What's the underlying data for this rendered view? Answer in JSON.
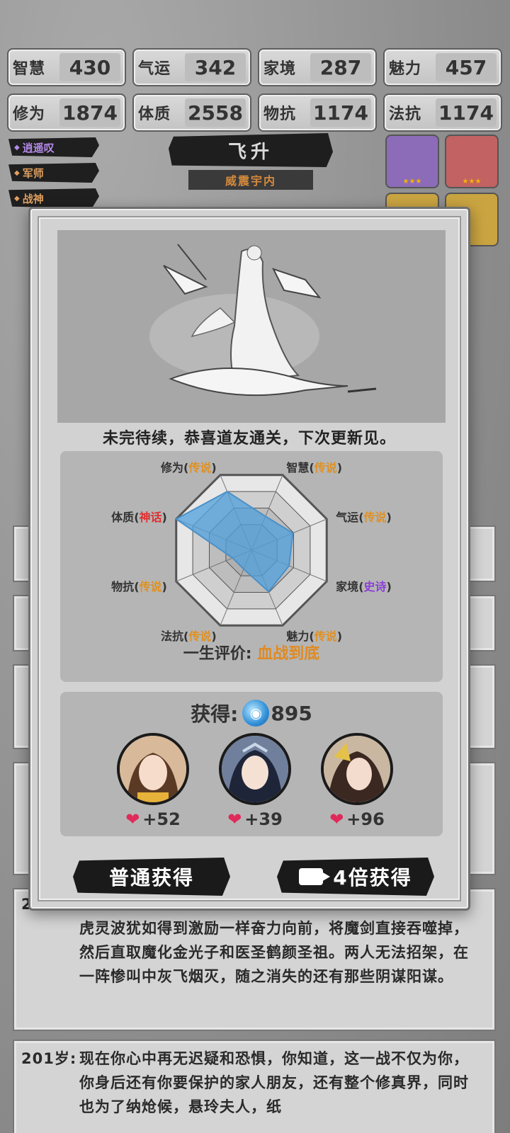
{
  "stats": [
    {
      "label": "智慧",
      "value": "430"
    },
    {
      "label": "气运",
      "value": "342"
    },
    {
      "label": "家境",
      "value": "287"
    },
    {
      "label": "魅力",
      "value": "457"
    },
    {
      "label": "修为",
      "value": "1874"
    },
    {
      "label": "体质",
      "value": "2558"
    },
    {
      "label": "物抗",
      "value": "1174"
    },
    {
      "label": "法抗",
      "value": "1174"
    }
  ],
  "titles": [
    "逍遥叹",
    "军师",
    "战神"
  ],
  "header": {
    "title": "飞升",
    "subtitle": "威震宇内"
  },
  "log": {
    "entry_age_partial": "2",
    "entry_text": "虎灵波犹如得到激励一样奋力向前，将魔剑直接吞噬掉，然后直取魔化金光子和医圣鹤颜圣祖。两人无法招架，在一阵惨叫中灰飞烟灭，随之消失的还有那些阴谋阳谋。",
    "next_age": "201岁:",
    "next_text": "现在你心中再无迟疑和恐惧，你知道，这一战不仅为你，你身后还有你要保护的家人朋友，还有整个修真界，同时也为了纳炝候，悬玲夫人，纸"
  },
  "modal": {
    "message": "未完待续，恭喜道友通关，下次更新见。",
    "radar": {
      "axes": [
        {
          "name": "修为",
          "grade": "传说",
          "gclass": "legend",
          "value": 0.78
        },
        {
          "name": "智慧",
          "grade": "传说",
          "gclass": "legend",
          "value": 0.45
        },
        {
          "name": "气运",
          "grade": "传说",
          "gclass": "legend",
          "value": 0.55
        },
        {
          "name": "家境",
          "grade": "史诗",
          "gclass": "epic",
          "value": 0.5
        },
        {
          "name": "魅力",
          "grade": "传说",
          "gclass": "legend",
          "value": 0.55
        },
        {
          "name": "法抗",
          "grade": "传说",
          "gclass": "legend",
          "value": 0.25
        },
        {
          "name": "物抗",
          "grade": "传说",
          "gclass": "legend",
          "value": 0.25
        },
        {
          "name": "体质",
          "grade": "神话",
          "gclass": "myth",
          "value": 1.0
        }
      ]
    },
    "evaluation_label": "一生评价:",
    "evaluation_value": "血战到底",
    "reward": {
      "label": "获得:",
      "amount": "895"
    },
    "heroes": [
      {
        "affinity": "+52"
      },
      {
        "affinity": "+39"
      },
      {
        "affinity": "+96"
      }
    ],
    "buttons": {
      "normal": "普通获得",
      "ad": "4倍获得"
    }
  }
}
